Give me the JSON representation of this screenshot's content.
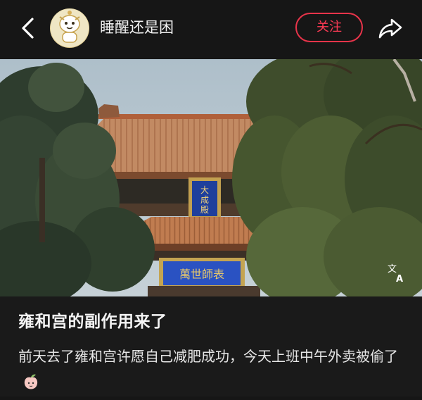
{
  "header": {
    "username": "睡醒还是困",
    "follow_label": "关注",
    "icons": {
      "back": "chevron-left-icon",
      "share": "share-arrow-icon",
      "avatar": "avatar-image"
    },
    "accent_color": "#e8344a"
  },
  "photo": {
    "plaque_vertical": "大成殿",
    "plaque_horizontal": "萬世師表",
    "translate_icon": "translate-icon"
  },
  "post": {
    "title": "雍和宫的副作用来了",
    "body": "前天去了雍和宫许愿自己减肥成功，今天上班中午外卖被偷了",
    "trailing_emoji": "peach-emoji-icon"
  }
}
